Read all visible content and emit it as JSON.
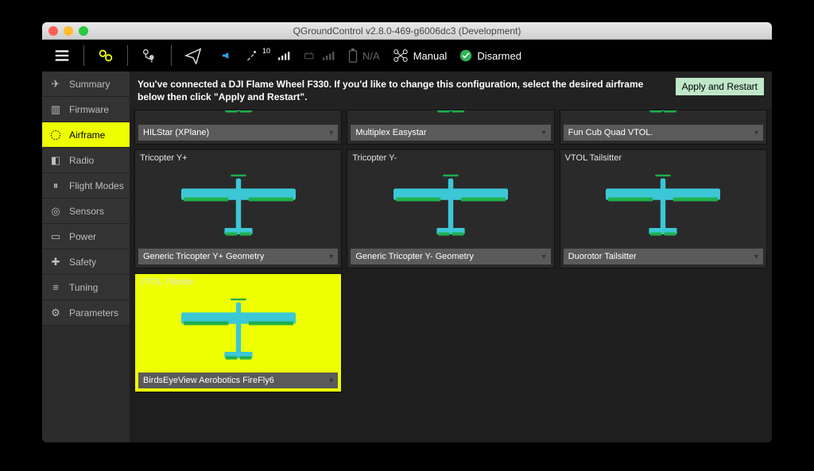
{
  "window": {
    "title": "QGroundControl v2.8.0-469-g6006dc3 (Development)"
  },
  "status": {
    "battery": "N/A",
    "mode": "Manual",
    "armed": "Disarmed"
  },
  "sidebar": {
    "items": [
      {
        "label": "Summary"
      },
      {
        "label": "Firmware"
      },
      {
        "label": "Airframe"
      },
      {
        "label": "Radio"
      },
      {
        "label": "Flight Modes"
      },
      {
        "label": "Sensors"
      },
      {
        "label": "Power"
      },
      {
        "label": "Safety"
      },
      {
        "label": "Tuning"
      },
      {
        "label": "Parameters"
      }
    ],
    "activeIndex": 2
  },
  "header": {
    "message": "You've connected a DJI Flame Wheel F330. If you'd like to change this configuration, select the desired airframe below then click \"Apply and Restart\".",
    "apply_label": "Apply and Restart"
  },
  "cards": [
    {
      "title": "",
      "select": "HILStar (XPlane)",
      "partial": true
    },
    {
      "title": "",
      "select": "Multiplex Easystar",
      "partial": true
    },
    {
      "title": "",
      "select": "Fun Cub Quad VTOL.",
      "partial": true
    },
    {
      "title": "Tricopter Y+",
      "select": "Generic Tricopter Y+ Geometry"
    },
    {
      "title": "Tricopter Y-",
      "select": "Generic Tricopter Y- Geometry"
    },
    {
      "title": "VTOL Tailsitter",
      "select": "Duorotor Tailsitter"
    },
    {
      "title": "VTOL Tiltrotor",
      "select": "BirdsEyeView Aerobotics FireFly6",
      "selected": true
    }
  ]
}
